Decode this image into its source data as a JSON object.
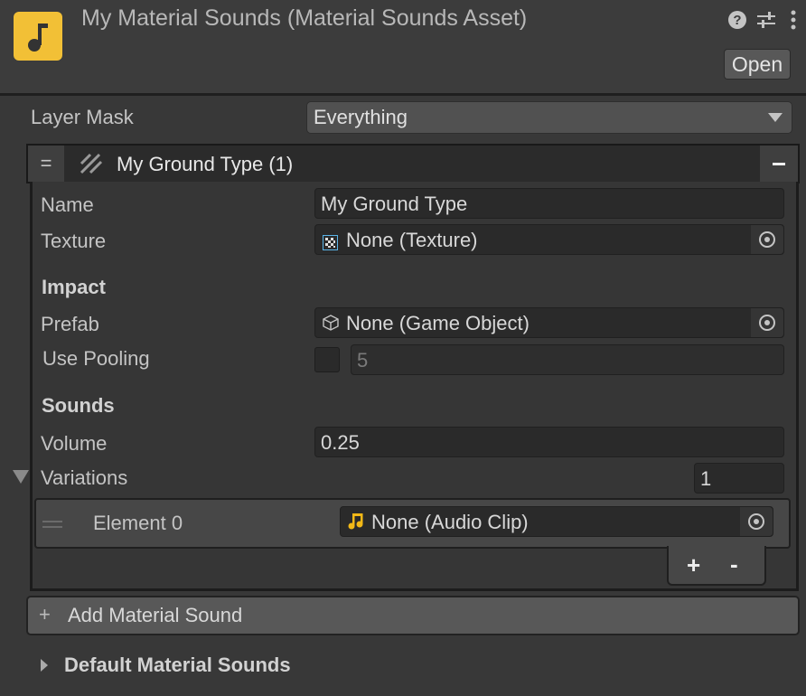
{
  "header": {
    "title": "My Material Sounds (Material Sounds Asset)",
    "asset_icon": "music-note-icon",
    "icons": [
      "help-icon",
      "presets-icon",
      "more-options-icon"
    ],
    "open_label": "Open",
    "help_glyph": "?",
    "presets_glyph": "⧧",
    "more_glyph": "⋮"
  },
  "layer_mask": {
    "label": "Layer Mask",
    "value": "Everything"
  },
  "ground_type": {
    "header": "My Ground Type (1)",
    "handle_glyph": "=",
    "name_label": "Name",
    "name_value": "My Ground Type",
    "texture_label": "Texture",
    "texture_value": "None (Texture)",
    "impact_heading": "Impact",
    "prefab_label": "Prefab",
    "prefab_value": "None (Game Object)",
    "use_pooling_label": "Use Pooling",
    "use_pooling_checked": false,
    "pool_size": "5",
    "sounds_heading": "Sounds",
    "volume_label": "Volume",
    "volume_value": "0.25",
    "variations_label": "Variations",
    "variations_count": "1",
    "elements": [
      {
        "label": "Element 0",
        "value": "None (Audio Clip)"
      }
    ],
    "add_glyph": "+",
    "remove_glyph": "-"
  },
  "add_material_sound": {
    "glyph": "+",
    "label": "Add Material Sound"
  },
  "default_material_sounds": {
    "label": "Default Material Sounds"
  },
  "colors": {
    "asset_icon": "#f2c036",
    "audio_icon": "#f2b817",
    "texture_icon": "#5ab4e8"
  }
}
